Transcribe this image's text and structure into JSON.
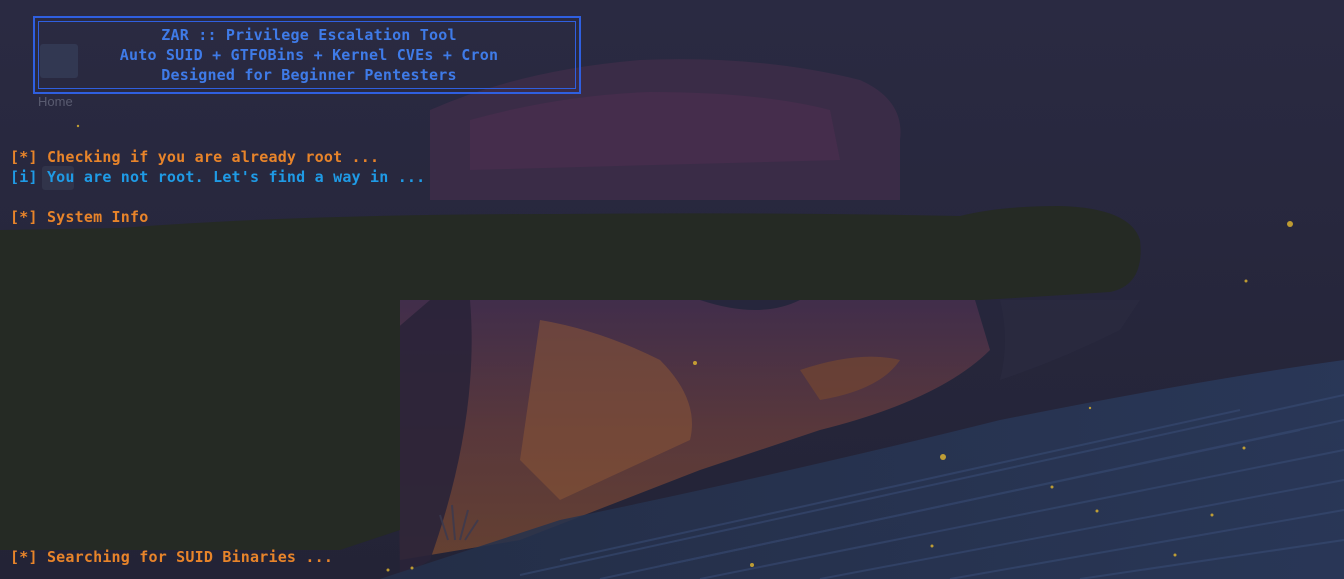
{
  "desktop": {
    "home_icon_label": "Home"
  },
  "banner": {
    "line1": "ZAR :: Privilege Escalation Tool",
    "line2": "Auto SUID + GTFOBins + Kernel CVEs + Cron",
    "line3": "Designed for Beginner Pentesters"
  },
  "output": {
    "check_prefix": "[*]",
    "check_text": "Checking if you are already root ...",
    "info_prefix": "[i]",
    "info_text": "You are not root. Let's find a way in ...",
    "sysinfo_prefix": "[*]",
    "sysinfo_text": "System Info",
    "suid_prefix": "[*]",
    "suid_text": "Searching for SUID Binaries ..."
  },
  "colors": {
    "banner": "#3f7be8",
    "status": "#e8842a",
    "info": "#1f9be6",
    "background": "#252538"
  }
}
